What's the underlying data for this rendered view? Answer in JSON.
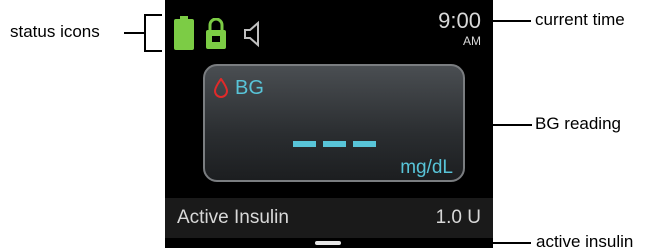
{
  "callouts": {
    "status_icons": "status icons",
    "current_time": "current time",
    "bg_reading": "BG reading",
    "active_insulin": "active insulin"
  },
  "status_bar": {
    "time": "9:00",
    "ampm": "AM",
    "icons": [
      "battery-icon",
      "lock-icon",
      "speaker-icon"
    ]
  },
  "bg": {
    "label": "BG",
    "value": "– – –",
    "units": "mg/dL"
  },
  "active_insulin": {
    "label": "Active Insulin",
    "value": "1.0 U"
  },
  "colors": {
    "accent": "#58c4d8",
    "battery": "#7ccc45",
    "drop": "#e02a2a"
  }
}
